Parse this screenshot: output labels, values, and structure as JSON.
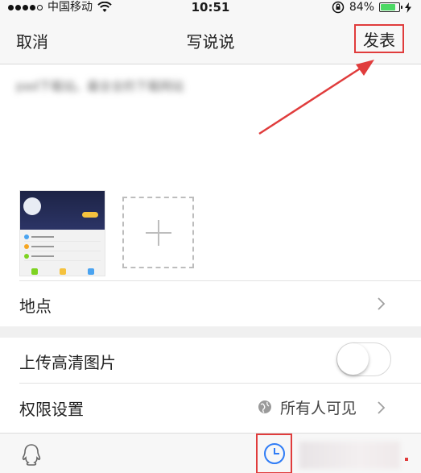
{
  "status_bar": {
    "carrier": "中国移动",
    "time": "10:51",
    "battery": "84%",
    "battery_level": 0.84
  },
  "nav": {
    "cancel": "取消",
    "title": "写说说",
    "publish": "发表"
  },
  "compose": {
    "placeholder": "pad下载站。最全全的下载网站"
  },
  "list": {
    "location": "地点",
    "hd_upload": "上传高清图片",
    "hd_upload_on": false,
    "permission": "权限设置",
    "permission_value": "所有人可见"
  },
  "colors": {
    "accent_red": "#e03c3c",
    "timer_blue": "#2f7cf6",
    "battery_green": "#4cd964"
  },
  "icons": {
    "add": "plus-icon",
    "chevron": "chevron-right-icon",
    "globe": "globe-icon",
    "qq": "qq-penguin-icon",
    "timer": "clock-icon"
  }
}
